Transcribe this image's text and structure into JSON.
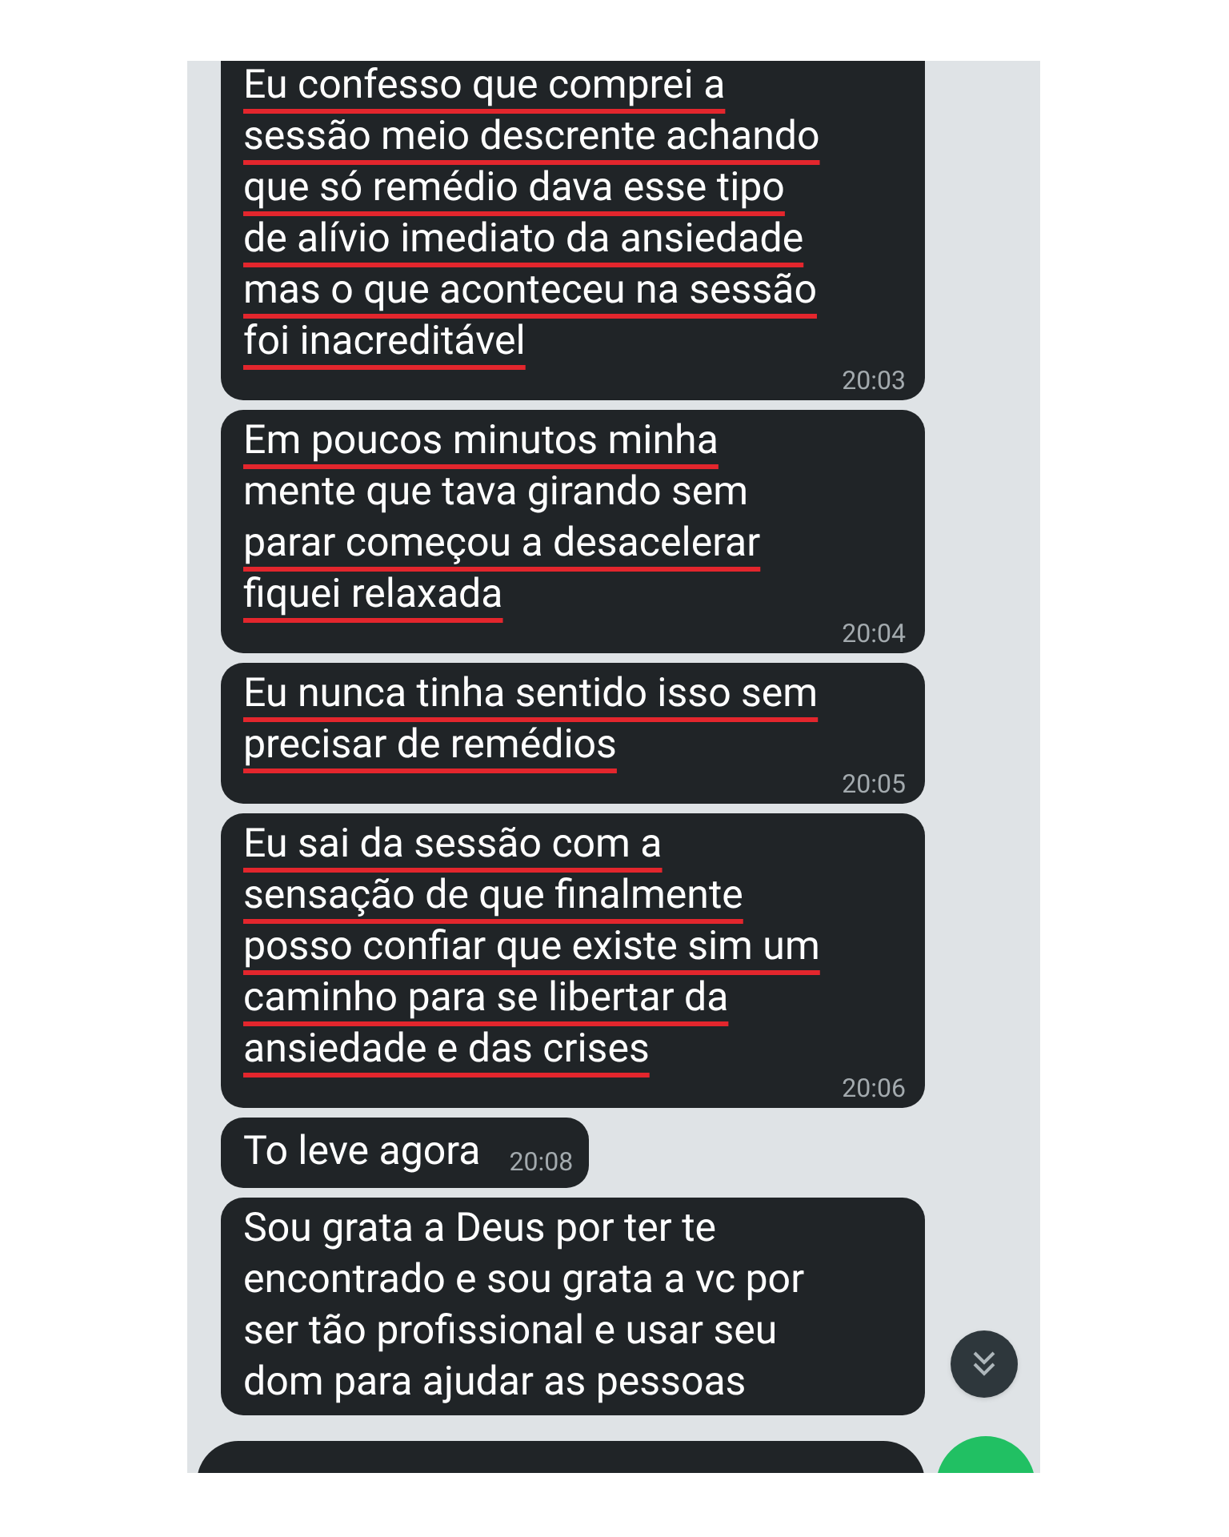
{
  "messages": [
    {
      "lines": [
        {
          "text": "Eu confesso que comprei a",
          "underlined": true
        },
        {
          "text": "sessão meio descrente achando",
          "underlined": true
        },
        {
          "text": "que só remédio dava esse tipo",
          "underlined": true
        },
        {
          "text": "de alívio imediato da ansiedade",
          "underlined": true
        },
        {
          "text": "mas o que aconteceu na sessão",
          "underlined": true
        },
        {
          "text": "foi inacreditável",
          "underlined": true
        }
      ],
      "time": "20:03"
    },
    {
      "lines": [
        {
          "text": "Em poucos minutos minha",
          "underlined": true
        },
        {
          "text": "mente que tava girando sem",
          "underlined": false
        },
        {
          "text": "parar começou a desacelerar",
          "underlined": true
        },
        {
          "text": "fiquei relaxada",
          "underlined": true
        }
      ],
      "time": "20:04"
    },
    {
      "lines": [
        {
          "text": "Eu nunca tinha sentido isso sem",
          "underlined": true
        },
        {
          "text": "precisar de remédios",
          "underlined": true
        }
      ],
      "time": "20:05"
    },
    {
      "lines": [
        {
          "text": "Eu sai da sessão com a",
          "underlined": true
        },
        {
          "text": "sensação de que finalmente",
          "underlined": true
        },
        {
          "text": "posso confiar que existe sim um",
          "underlined": true
        },
        {
          "text": "caminho para se libertar da",
          "underlined": true
        },
        {
          "text": "ansiedade e das crises",
          "underlined": true
        }
      ],
      "time": "20:06"
    },
    {
      "lines": [
        {
          "text": "To leve agora",
          "underlined": false
        }
      ],
      "time": "20:08"
    },
    {
      "lines": [
        {
          "text": "Sou grata a Deus por ter te",
          "underlined": false
        },
        {
          "text": "encontrado e sou grata a vc por",
          "underlined": false
        },
        {
          "text": "ser tão profissional e usar seu",
          "underlined": false
        },
        {
          "text": "dom para ajudar as pessoas",
          "underlined": false
        }
      ]
    }
  ]
}
